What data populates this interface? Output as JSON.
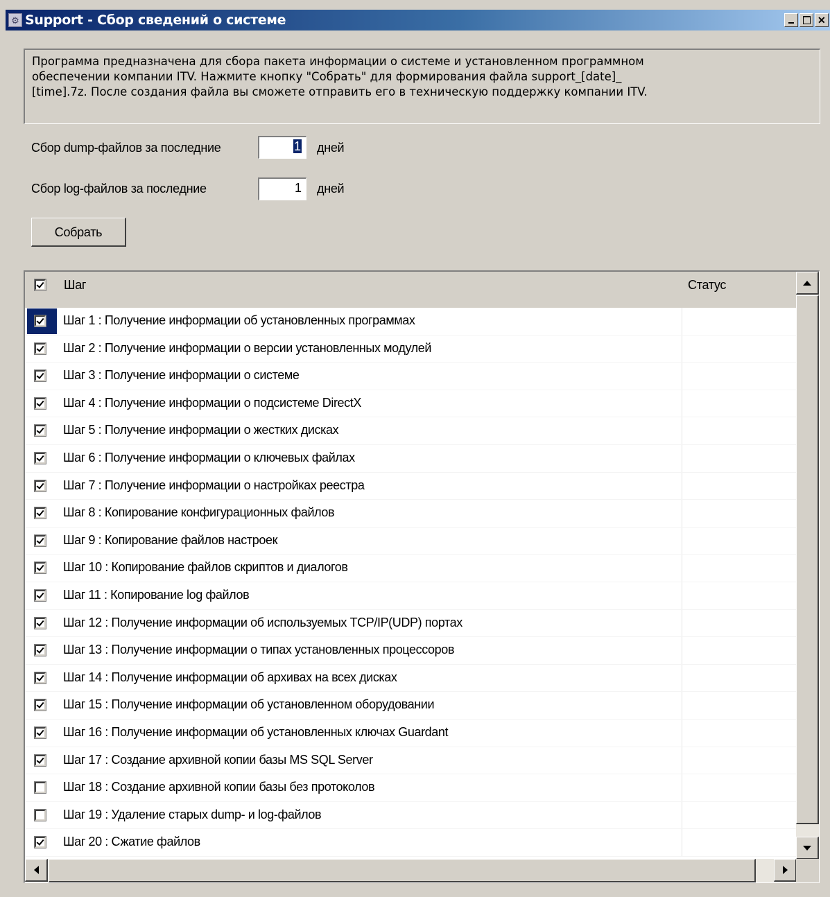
{
  "window": {
    "title": "Support - Сбор сведений о системе",
    "minimize": "_",
    "maximize": "□",
    "close": "✕"
  },
  "description": "Программа предназначена для сбора пакета информации о системе и установленном программном\nобеспечении компании ITV. Нажмите кнопку \"Собрать\" для формирования файла support_[date]_\n[time].7z. После создания файла вы сможете отправить его в техническую поддержку компании ITV.",
  "dump": {
    "label": "Сбор dump-файлов за последние",
    "value": "1",
    "unit": "дней"
  },
  "log": {
    "label": "Сбор log-файлов за последние",
    "value": "1",
    "unit": "дней"
  },
  "collect_button": "Собрать",
  "list": {
    "header_checked": true,
    "col_step": "Шаг",
    "col_status": "Статус",
    "steps": [
      {
        "label": "Шаг 1 : Получение информации об установленных программах",
        "checked": true,
        "status": ""
      },
      {
        "label": "Шаг 2 : Получение информации о версии установленных модулей",
        "checked": true,
        "status": ""
      },
      {
        "label": "Шаг 3 : Получение информации о системе",
        "checked": true,
        "status": ""
      },
      {
        "label": "Шаг 4 : Получение информации о подсистеме DirectX",
        "checked": true,
        "status": ""
      },
      {
        "label": "Шаг 5 : Получение информации о жестких дисках",
        "checked": true,
        "status": ""
      },
      {
        "label": "Шаг 6 : Получение информации о ключевых файлах",
        "checked": true,
        "status": ""
      },
      {
        "label": "Шаг 7 : Получение информации о настройках реестра",
        "checked": true,
        "status": ""
      },
      {
        "label": "Шаг 8 : Копирование конфигурационных файлов",
        "checked": true,
        "status": ""
      },
      {
        "label": "Шаг 9 : Копирование файлов настроек",
        "checked": true,
        "status": ""
      },
      {
        "label": "Шаг 10 : Копирование файлов скриптов и диалогов",
        "checked": true,
        "status": ""
      },
      {
        "label": "Шаг 11 : Копирование log файлов",
        "checked": true,
        "status": ""
      },
      {
        "label": "Шаг 12 : Получение информации об используемых TCP/IP(UDP) портах",
        "checked": true,
        "status": ""
      },
      {
        "label": "Шаг 13 : Получение информации о типах установленных процессоров",
        "checked": true,
        "status": ""
      },
      {
        "label": "Шаг 14 : Получение информации об архивах на всех дисках",
        "checked": true,
        "status": ""
      },
      {
        "label": "Шаг 15 : Получение информации об установленном оборудовании",
        "checked": true,
        "status": ""
      },
      {
        "label": "Шаг 16 : Получение информации об установленных ключах Guardant",
        "checked": true,
        "status": ""
      },
      {
        "label": "Шаг 17 : Создание архивной копии базы MS SQL Server",
        "checked": true,
        "status": ""
      },
      {
        "label": "Шаг 18 : Создание архивной копии базы без протоколов",
        "checked": false,
        "status": ""
      },
      {
        "label": "Шаг 19 : Удаление старых dump- и log-файлов",
        "checked": false,
        "status": ""
      },
      {
        "label": "Шаг 20 : Сжатие файлов",
        "checked": true,
        "status": ""
      }
    ]
  }
}
